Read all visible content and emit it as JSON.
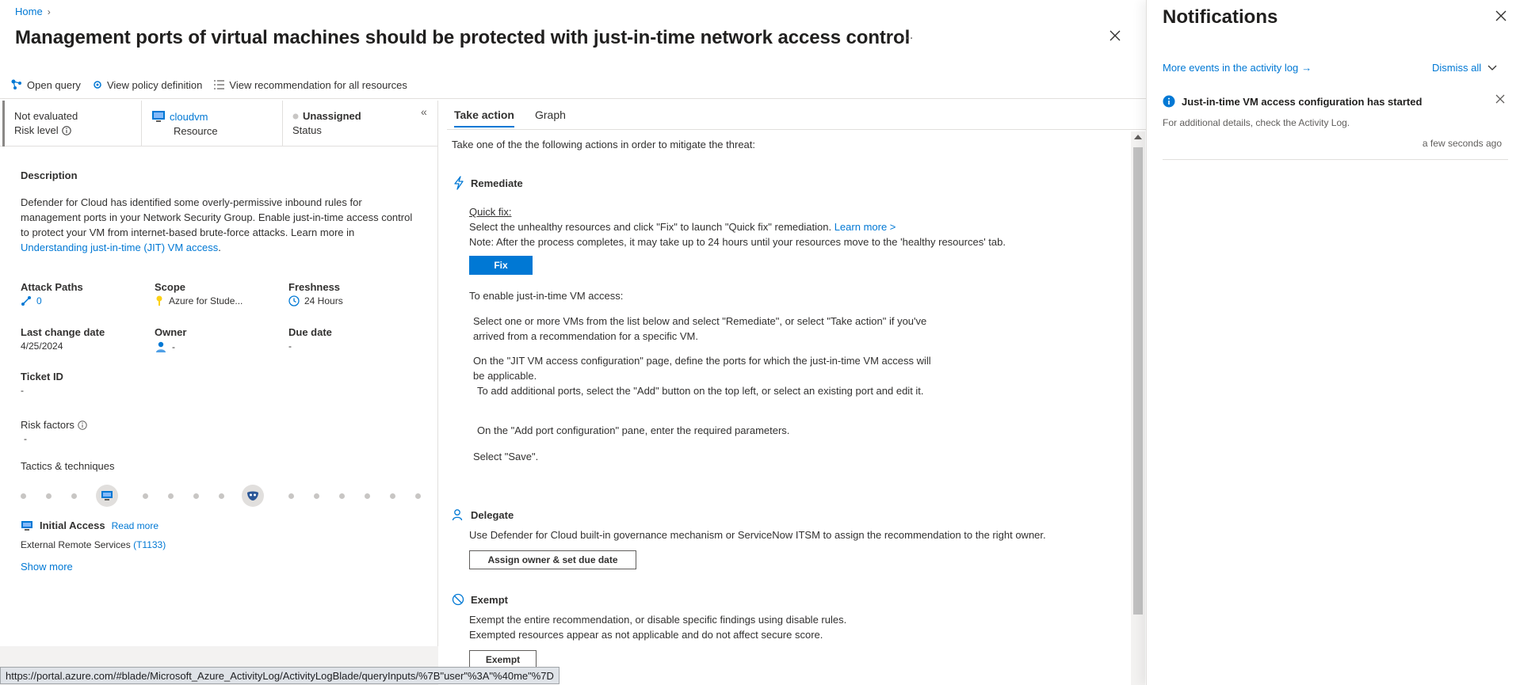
{
  "breadcrumb": {
    "home": "Home"
  },
  "title": "Management ports of virtual machines should be protected with just-in-time network access control",
  "more": "...",
  "toolbar": {
    "open_query": "Open query",
    "view_policy": "View policy definition",
    "view_all": "View recommendation for all resources"
  },
  "summary": {
    "risk_value": "Not evaluated",
    "risk_label": "Risk level",
    "resource_value": "cloudvm",
    "resource_label": "Resource",
    "status_value": "Unassigned",
    "status_label": "Status"
  },
  "description": {
    "title": "Description",
    "text": "Defender for Cloud has identified some overly-permissive inbound rules for management ports in your Network Security Group. Enable just-in-time access control to protect your VM from internet-based brute-force attacks. Learn more in ",
    "link": "Understanding just-in-time (JIT) VM access",
    "end": "."
  },
  "details": {
    "attack_paths": {
      "title": "Attack Paths",
      "value": "0"
    },
    "scope": {
      "title": "Scope",
      "value": "Azure for Stude..."
    },
    "freshness": {
      "title": "Freshness",
      "value": "24 Hours"
    },
    "last_change": {
      "title": "Last change date",
      "value": "4/25/2024"
    },
    "owner": {
      "title": "Owner",
      "value": "-"
    },
    "due_date": {
      "title": "Due date",
      "value": "-"
    },
    "ticket": {
      "title": "Ticket ID",
      "value": "-"
    },
    "risk_factors": {
      "title": "Risk factors",
      "value": "-"
    }
  },
  "tactics": {
    "title": "Tactics & techniques",
    "initial_access": "Initial Access",
    "read_more": "Read more",
    "technique": "External Remote Services",
    "technique_id": "(T1133)",
    "show_more": "Show more"
  },
  "tabs": [
    "Take action",
    "Graph"
  ],
  "actions": {
    "intro": "Take one of the the following actions in order to mitigate the threat:",
    "remediate": {
      "title": "Remediate",
      "quick_fix": "Quick fix:",
      "line1": "Select the unhealthy resources and click \"Fix\" to launch \"Quick fix\" remediation.",
      "learn_more": "Learn more >",
      "line2": "Note: After the process completes, it may take up to 24 hours until your resources move to the 'healthy resources' tab.",
      "fix_button": "Fix",
      "jit_intro": "To enable just-in-time VM access:",
      "step1": "Select one or more VMs from the list below and select \"Remediate\", or select \"Take action\" if you've arrived from a recommendation for a specific VM.",
      "step2": "On the \"JIT VM access configuration\" page, define the ports for which the just-in-time VM access will be applicable.",
      "step3": "To add additional ports, select the \"Add\" button on the top left, or select an existing port and edit it.",
      "step4": "On the \"Add port configuration\" pane, enter the required parameters.",
      "step5": "Select \"Save\"."
    },
    "delegate": {
      "title": "Delegate",
      "text": "Use Defender for Cloud built-in governance mechanism or ServiceNow ITSM to assign the recommendation to the right owner.",
      "button": "Assign owner & set due date"
    },
    "exempt": {
      "title": "Exempt",
      "line1": "Exempt the entire recommendation, or disable specific findings using disable rules.",
      "line2": "Exempted resources appear as not applicable and do not affect secure score.",
      "button": "Exempt"
    }
  },
  "notifications": {
    "title": "Notifications",
    "activity_link": "More events in the activity log",
    "activity_arrow": "→",
    "dismiss_all": "Dismiss all",
    "item_title": "Just-in-time VM access configuration has started",
    "item_body": "For additional details, check the Activity Log.",
    "item_time": "a few seconds ago"
  },
  "status_url": "https://portal.azure.com/#blade/Microsoft_Azure_ActivityLog/ActivityLogBlade/queryInputs/%7B\"user\"%3A\"%40me\"%7D",
  "colors": {
    "accent": "#0078d4",
    "info": "#0078d4",
    "bolt": "#0078d4"
  }
}
